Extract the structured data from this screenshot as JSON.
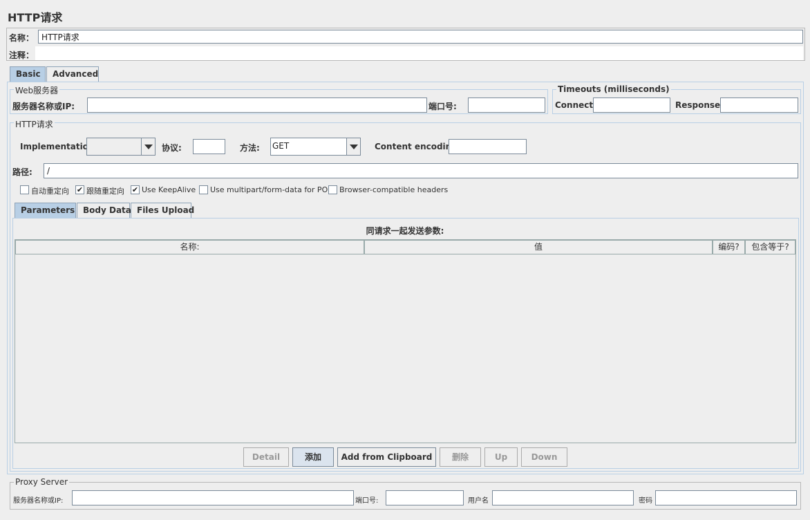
{
  "window_title": "HTTP请求",
  "name_label": "名称：",
  "name_value": "HTTP请求",
  "comment_label": "注释：",
  "comment_value": "",
  "tabs": [
    {
      "label": "Basic",
      "active": true
    },
    {
      "label": "Advanced",
      "active": false
    }
  ],
  "web_server": {
    "title": "Web服务器",
    "server_label": "服务器名称或IP:",
    "server_value": "",
    "port_label": "端口号:",
    "port_value": ""
  },
  "timeouts": {
    "title": "Timeouts (milliseconds)",
    "connect_label": "Connect:",
    "connect_value": "",
    "response_label": "Response:",
    "response_value": ""
  },
  "http_request": {
    "title": "HTTP请求",
    "implementation_label": "Implementation:",
    "implementation_value": "",
    "protocol_label": "协议:",
    "protocol_value": "",
    "method_label": "方法:",
    "method_value": "GET",
    "encoding_label": "Content encoding:",
    "encoding_value": "",
    "path_label": "路径:",
    "path_value": "/",
    "checkboxes": [
      {
        "label": "自动重定向",
        "checked": false
      },
      {
        "label": "跟随重定向",
        "checked": true
      },
      {
        "label": "Use KeepAlive",
        "checked": true
      },
      {
        "label": "Use multipart/form-data for POST",
        "checked": false
      },
      {
        "label": "Browser-compatible headers",
        "checked": false
      }
    ]
  },
  "param_tabs": [
    {
      "label": "Parameters",
      "active": true
    },
    {
      "label": "Body Data",
      "active": false
    },
    {
      "label": "Files Upload",
      "active": false
    }
  ],
  "params_table": {
    "caption": "同请求一起发送参数:",
    "columns": [
      "名称:",
      "值",
      "编码?",
      "包含等于?"
    ],
    "rows": []
  },
  "buttons": {
    "detail": "Detail",
    "add": "添加",
    "add_clipboard": "Add from Clipboard",
    "delete": "删除",
    "up": "Up",
    "down": "Down"
  },
  "proxy": {
    "title": "Proxy Server",
    "server_label": "服务器名称或IP:",
    "server_value": "",
    "port_label": "端口号:",
    "port_value": "",
    "user_label": "用户名",
    "user_value": "",
    "password_label": "密码",
    "password_value": ""
  }
}
